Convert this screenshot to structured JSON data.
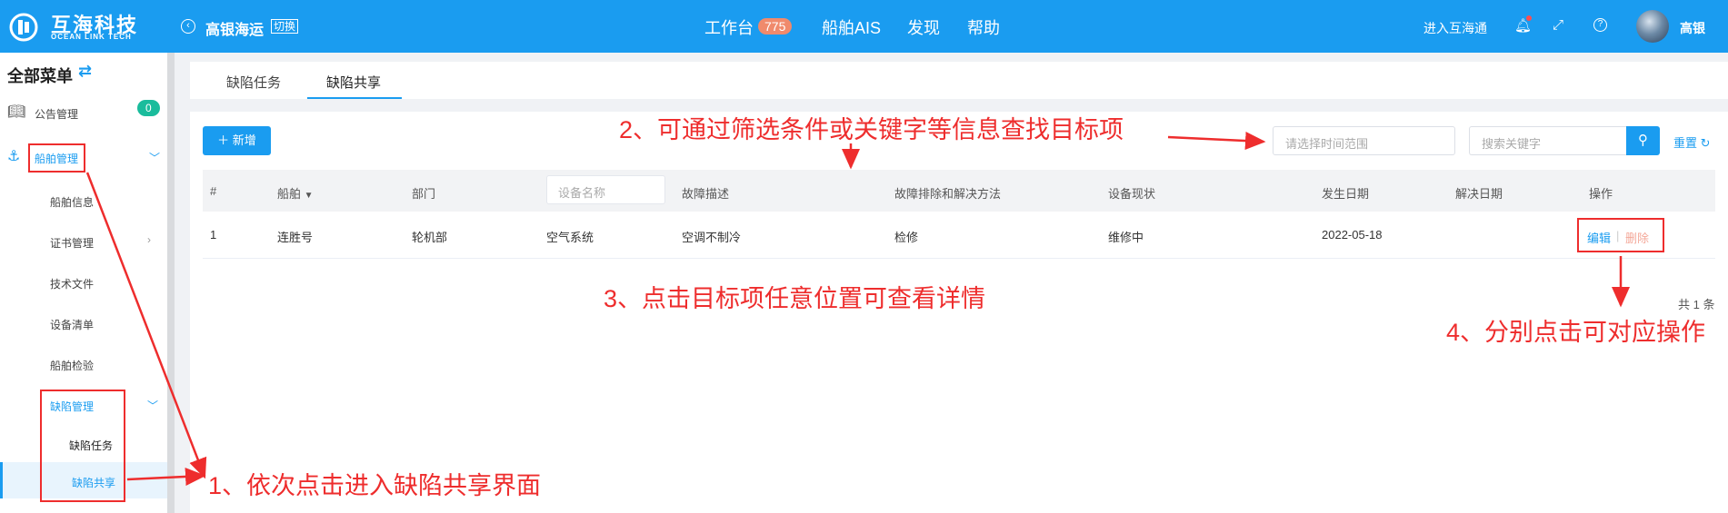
{
  "header": {
    "brand_cn": "互海科技",
    "brand_en": "OCEAN LINK TECH",
    "company": "高银海运",
    "switch_label": "切换",
    "nav": [
      {
        "label": "工作台",
        "badge": "775"
      },
      {
        "label": "船舶AIS"
      },
      {
        "label": "发现"
      },
      {
        "label": "帮助"
      }
    ],
    "enter_link": "进入互海通",
    "username": "高银"
  },
  "sidebar": {
    "title": "全部菜单",
    "items": [
      {
        "label": "公告管理",
        "badge": "0"
      },
      {
        "label": "船舶管理"
      },
      {
        "label": "船舶信息"
      },
      {
        "label": "证书管理"
      },
      {
        "label": "技术文件"
      },
      {
        "label": "设备清单"
      },
      {
        "label": "船舶检验"
      },
      {
        "label": "缺陷管理"
      },
      {
        "label": "缺陷任务"
      },
      {
        "label": "缺陷共享"
      }
    ]
  },
  "tabs": [
    "缺陷任务",
    "缺陷共享"
  ],
  "toolbar": {
    "add_label": "新增",
    "date_placeholder": "请选择时间范围",
    "keyword_placeholder": "搜索关键字",
    "reset_label": "重置"
  },
  "table": {
    "columns": [
      "#",
      "船舶",
      "部门",
      "设备名称",
      "故障描述",
      "故障排除和解决方法",
      "设备现状",
      "发生日期",
      "解决日期",
      "操作"
    ],
    "rows": [
      {
        "index": "1",
        "ship": "连胜号",
        "dept": "轮机部",
        "equipment": "空气系统",
        "fault": "空调不制冷",
        "solution": "检修",
        "status": "维修中",
        "date": "2022-05-18",
        "resolved": "",
        "edit": "编辑",
        "delete": "删除"
      }
    ],
    "total": "共 1 条"
  },
  "annotations": {
    "step1": "1、依次点击进入缺陷共享界面",
    "step2": "2、可通过筛选条件或关键字等信息查找目标项",
    "step3": "3、点击目标项任意位置可查看详情",
    "step4": "4、分别点击可对应操作"
  },
  "colors": {
    "brand": "#1a9cf0",
    "annotation": "#ee2d2d",
    "badge": "#f08a6c",
    "sidebar_badge": "#1abc9c"
  }
}
